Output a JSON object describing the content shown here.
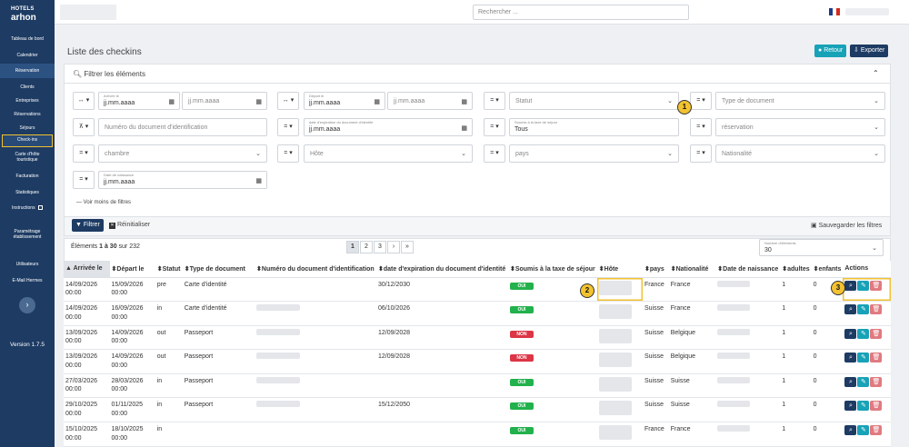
{
  "app": {
    "logo_line1": "HOTELS",
    "logo_line2": "arhon",
    "version": "Version 1.7.5"
  },
  "sidebar": {
    "items": [
      {
        "label": "Tableau de bord"
      },
      {
        "label": "Calendrier"
      },
      {
        "label": "Réservation"
      },
      {
        "label": "Clients"
      },
      {
        "label": "Entreprises"
      },
      {
        "label": "Réservations"
      },
      {
        "label": "Séjours"
      },
      {
        "label": "Check-ins"
      },
      {
        "label": "Carte d'hôte touristique"
      },
      {
        "label": "Facturation"
      },
      {
        "label": "Statistiques"
      },
      {
        "label": "Instructions"
      },
      {
        "label": "Paramétrage établissement"
      },
      {
        "label": "Utilisateurs"
      },
      {
        "label": "E-Mail Hermes"
      }
    ],
    "collapse_icon": "›"
  },
  "topbar": {
    "search_placeholder": "Rechercher ..."
  },
  "page": {
    "title": "Liste des checkins",
    "retour": "Retour",
    "exporter": "Exporter"
  },
  "filters": {
    "header": "Filtrer les éléments",
    "collapse_icon": "⌃",
    "arrivee_label": "Arrivée le",
    "depart_label": "Départ le",
    "date_ph": "jj.mm.aaaa",
    "statut": "Statut",
    "type_doc": "Type de document",
    "num_doc": "Numéro du document d'identification",
    "exp_label": "date d'expiration du document d'identité",
    "taxe_label": "Soumis à la taxe de séjour",
    "taxe_value": "Tous",
    "reservation": "réservation",
    "chambre": "chambre",
    "hote": "Hôte",
    "pays": "pays",
    "nationalite": "Nationalité",
    "naissance_label": "Date de naissance",
    "voir_moins": "Voir moins de filtres",
    "filtrer": "Filtrer",
    "reinitialiser": "Réinitialiser",
    "sauvegarder": "Sauvegarder les filtres"
  },
  "markers": [
    "1",
    "2",
    "3"
  ],
  "list": {
    "count_prefix": "Éléments ",
    "count_range": "1 à 30",
    "count_suffix": " sur 232",
    "pages": [
      "1",
      "2",
      "3",
      "›",
      "»"
    ],
    "per_page_label": "Nombre d'éléments",
    "per_page": "30"
  },
  "table": {
    "headers": [
      "Arrivée le",
      "Départ le",
      "Statut",
      "Type de document",
      "Numéro du document d'identification",
      "date d'expiration du document d'identité",
      "Soumis à la taxe de séjour",
      "Hôte",
      "pays",
      "Nationalité",
      "Date de naissance",
      "adultes",
      "enfants",
      "Actions"
    ],
    "rows": [
      {
        "arrivee": "14/09/2026",
        "arrivee_t": "00:00",
        "depart": "15/09/2026",
        "depart_t": "00:00",
        "statut": "pre",
        "type": "Carte d'identité",
        "exp": "30/12/2030",
        "taxe": "OUI",
        "pays": "France",
        "nat": "France",
        "adultes": "1",
        "enfants": "0"
      },
      {
        "arrivee": "14/09/2026",
        "arrivee_t": "00:00",
        "depart": "16/09/2026",
        "depart_t": "00:00",
        "statut": "in",
        "type": "Carte d'identité",
        "exp": "06/10/2026",
        "taxe": "OUI",
        "pays": "Suisse",
        "nat": "France",
        "adultes": "1",
        "enfants": "0"
      },
      {
        "arrivee": "13/09/2026",
        "arrivee_t": "00:00",
        "depart": "14/09/2026",
        "depart_t": "00:00",
        "statut": "out",
        "type": "Passeport",
        "exp": "12/09/2028",
        "taxe": "NON",
        "pays": "Suisse",
        "nat": "Belgique",
        "adultes": "1",
        "enfants": "0"
      },
      {
        "arrivee": "13/09/2026",
        "arrivee_t": "00:00",
        "depart": "14/09/2026",
        "depart_t": "00:00",
        "statut": "out",
        "type": "Passeport",
        "exp": "12/09/2028",
        "taxe": "NON",
        "pays": "Suisse",
        "nat": "Belgique",
        "adultes": "1",
        "enfants": "0"
      },
      {
        "arrivee": "27/03/2026",
        "arrivee_t": "00:00",
        "depart": "28/03/2026",
        "depart_t": "00:00",
        "statut": "in",
        "type": "Passeport",
        "exp": "",
        "taxe": "OUI",
        "pays": "Suisse",
        "nat": "Suisse",
        "adultes": "1",
        "enfants": "0"
      },
      {
        "arrivee": "29/10/2025",
        "arrivee_t": "00:00",
        "depart": "01/11/2025",
        "depart_t": "00:00",
        "statut": "in",
        "type": "Passeport",
        "exp": "15/12/2050",
        "taxe": "OUI",
        "pays": "Suisse",
        "nat": "Suisse",
        "adultes": "1",
        "enfants": "0"
      },
      {
        "arrivee": "15/10/2025",
        "arrivee_t": "00:00",
        "depart": "18/10/2025",
        "depart_t": "00:00",
        "statut": "in",
        "type": "",
        "exp": "",
        "taxe": "OUI",
        "pays": "France",
        "nat": "France",
        "adultes": "1",
        "enfants": "0"
      }
    ]
  },
  "colors": {
    "sidebar": "#1d3b63",
    "oui": "#22b14c",
    "non": "#dc3545",
    "teal": "#17a2b8",
    "navy": "#1d3b63",
    "highlight": "#f2c230"
  }
}
